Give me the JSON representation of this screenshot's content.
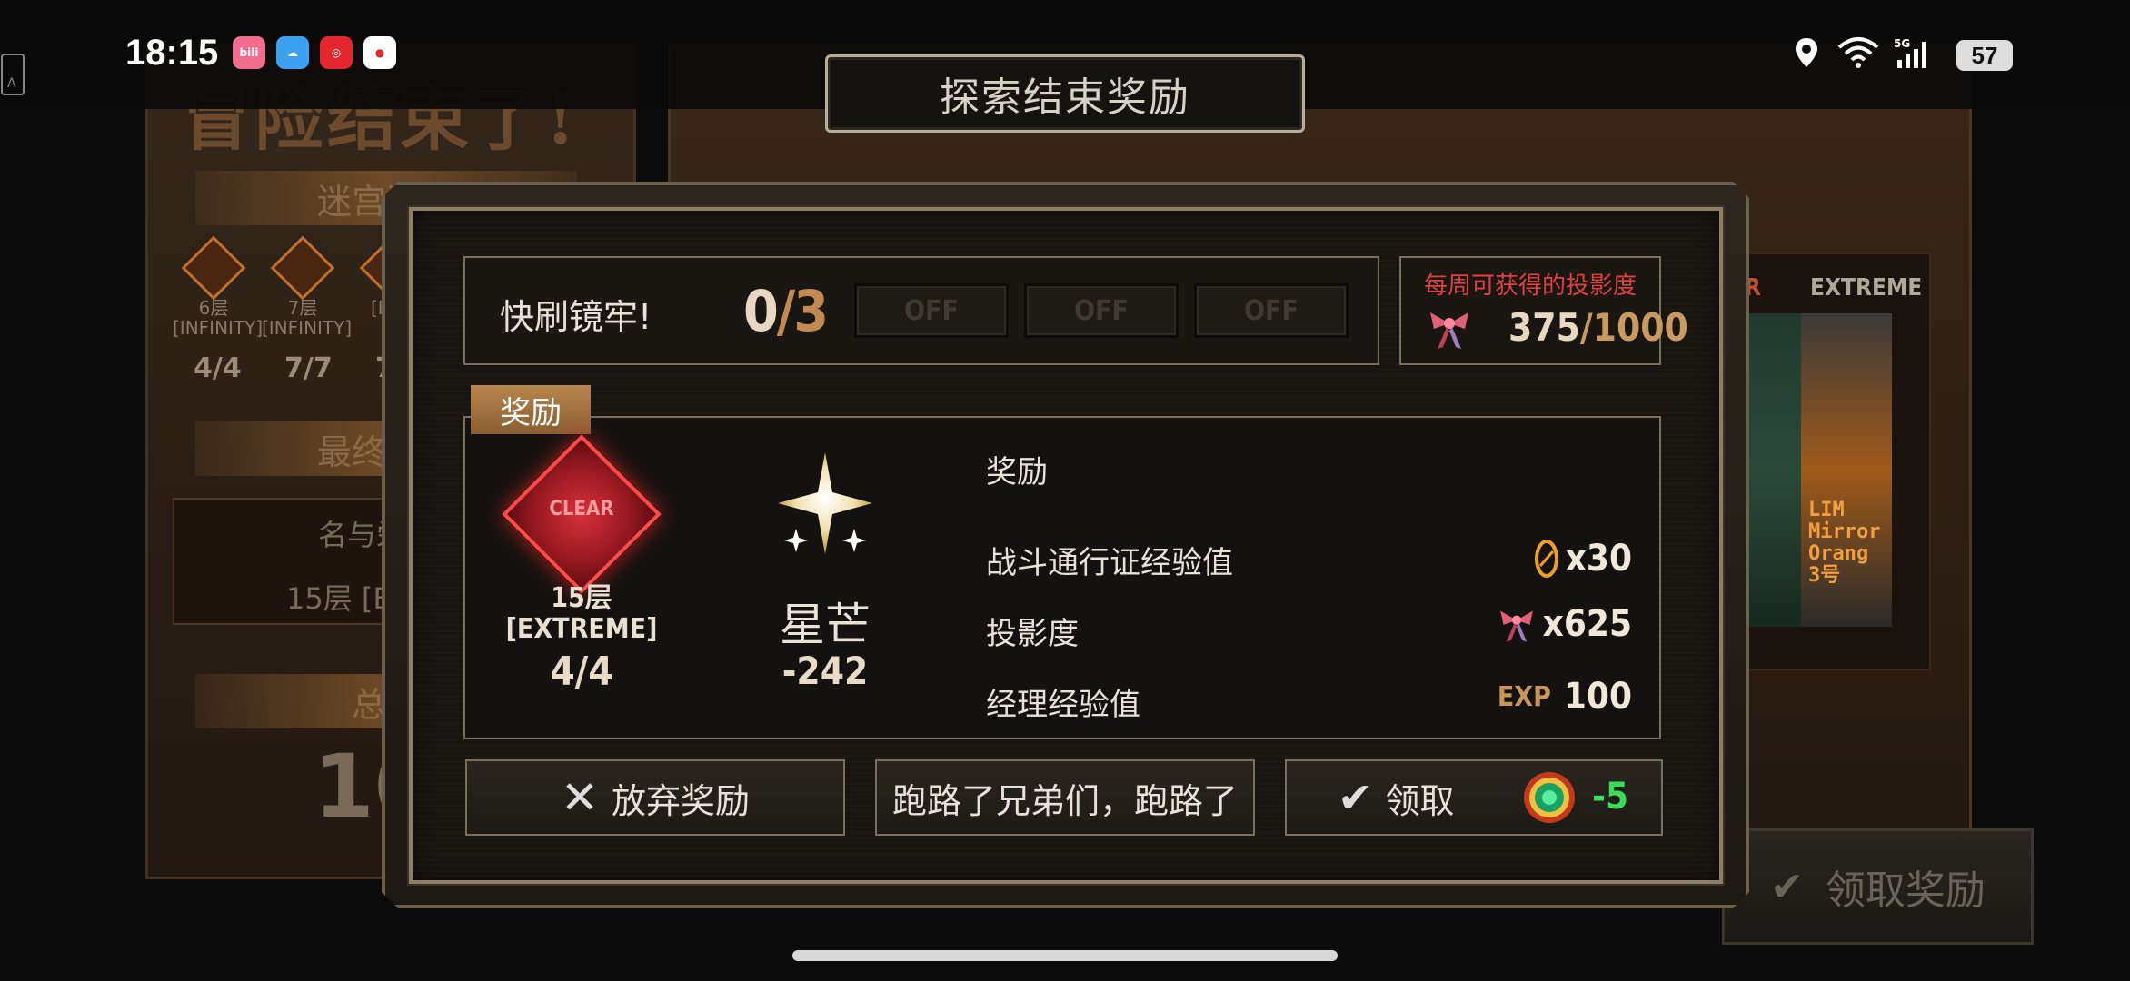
{
  "statusbar": {
    "time": "18:15",
    "battery": "57",
    "network": "5G",
    "icons": [
      "location-icon",
      "wifi-icon",
      "signal-icon"
    ],
    "apps": [
      {
        "name": "bilibili",
        "color": "#f16d8f"
      },
      {
        "name": "weather",
        "color": "#3ba1f0"
      },
      {
        "name": "netease-music",
        "color": "#e6262e"
      },
      {
        "name": "xiaohongshu-maps",
        "color": "#ffffff"
      }
    ]
  },
  "background": {
    "title": "冒险结束了!",
    "banner1": "迷宫进度",
    "banner2": "最终探索",
    "banner3": "总进",
    "floors": [
      {
        "label": "6层",
        "sub": "[INFINITY]",
        "frac": "4/4"
      },
      {
        "label": "7层",
        "sub": "[INFINITY]",
        "frac": "7/7"
      },
      {
        "label": "",
        "sub": "[INFI",
        "frac": "7/"
      }
    ],
    "row1": "名与栄",
    "row2": "15层 [EXT",
    "big_number": "100",
    "card_label_left": "OR",
    "card_label_right": "EXTREME",
    "card_text": [
      "LIM",
      "Mirror",
      "Orang",
      "3号"
    ],
    "claim_all": "领取奖励"
  },
  "title_bar": "探索结束奖励",
  "quick": {
    "label": "快刷镜牢!",
    "count": "0",
    "max": "3",
    "buttons": [
      "OFF",
      "OFF",
      "OFF"
    ]
  },
  "weekly": {
    "label": "每周可获得的投影度",
    "current": "375",
    "limit": "/1000"
  },
  "reward_tab": "奖励",
  "clear": {
    "badge": "CLEAR",
    "floor": "15层",
    "mode": "[EXTREME]",
    "progress": "4/4"
  },
  "star": {
    "name": "星芒",
    "value": "-242"
  },
  "rewards": {
    "heading": "奖励",
    "items": [
      {
        "label": "战斗通行证经验值",
        "prefix": "",
        "value": "x30",
        "icon": "battle-pass-token-icon"
      },
      {
        "label": "投影度",
        "prefix": "",
        "value": "x625",
        "icon": "ribbon-icon"
      },
      {
        "label": "经理经验值",
        "prefix": "EXP",
        "value": "100",
        "icon": ""
      }
    ]
  },
  "buttons": {
    "abandon": "放弃奖励",
    "run": "跑路了兄弟们，跑路了",
    "claim": "领取",
    "claim_cost": "-5"
  }
}
